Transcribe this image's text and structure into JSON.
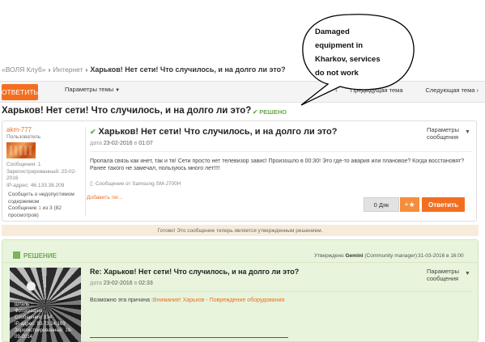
{
  "breadcrumb": {
    "items": [
      "«ВОЛЯ Клуб»",
      "Интернет"
    ],
    "current": "Харьков! Нет сети! Что случилось, и на долго ли это?"
  },
  "toolbar": {
    "reply_label": "ОТВЕТИТЬ",
    "topic_params_label": "Параметры темы",
    "prev_topic": "Предыдущая тема",
    "next_topic": "Следующая тема",
    "prev_partial": "С"
  },
  "topic": {
    "title": "Харьков! Нет сети! Что случилось, и на долго ли это?",
    "solved_label": "РЕШЕНО"
  },
  "post": {
    "author": {
      "name": "akm-777",
      "role": "Пользователь",
      "messages": "Сообщения: 1",
      "registered_label": "Зарегистрированный: 23-02-",
      "registered_year": "2016",
      "ip": "IP-адрес: 46.133.38.209"
    },
    "report": {
      "line1": "Сообщить о недопустимом",
      "line2": "содержимом",
      "msg_prefix": "Сообщение",
      "msg_num": "1",
      "msg_suffix": "из 3 (82",
      "views": "просмотров)"
    },
    "title": "Харьков! Нет сети! Что случилось, и на долго ли это?",
    "date_label": "дата",
    "date": "23-02-2016",
    "time_prefix": "в",
    "time": "01:07",
    "params_line1": "Параметры",
    "params_line2": "сообщения",
    "body": "Пропала связь как инет, так и тв!  Сети просто нет телевизор завис! Произошло в 00:30! Это где-то авария или плановое? Когда восстановят? Ранее такого не замечал, пользуюсь много лет!!!!",
    "sent_from": "Сообщение от Samsung SM-J700H",
    "add_tag": "Добавить тег...",
    "kudos_label": "0 Дяк",
    "answer_label": "Ответить"
  },
  "approved_notice": "Готово! Это сообщение теперь является утвержденным решением.",
  "solution": {
    "label": "РЕШЕНИЕ",
    "approved_by_prefix": "Утверждено",
    "approved_by_name": "Gemini",
    "approved_by_role": "(Community manager)",
    "approved_date": "31-03-2016 в 16:00",
    "author_overlay": {
      "line1": "Шталь",
      "line2": "Фотография",
      "messages": "Сообщения: 834",
      "ip": "IP-адрес: 93.73.24.163",
      "registered": "Зарегистрированный: 19-",
      "registered_year": "09-2014"
    },
    "title": "Re: Харьков! Нет сети! Что случилось, и на долго ли это?",
    "date_label": "дата",
    "date": "23-02-2016",
    "time_prefix": "в",
    "time": "02:33",
    "params_line1": "Параметры",
    "params_line2": "сообщения",
    "body_prefix": "Возможно эта причина :",
    "body_link": "Внимание! Харьков - Повреждение оборудования"
  },
  "annotation": {
    "line1": "Damaged",
    "line2": "equipment in",
    "line3": "Kharkov, services",
    "line4": "do not work"
  },
  "colors": {
    "accent": "#f26f21",
    "solved_green": "#6aa84f",
    "solution_bg": "#e8f4dc",
    "notice_bg": "#f7ecd9"
  }
}
